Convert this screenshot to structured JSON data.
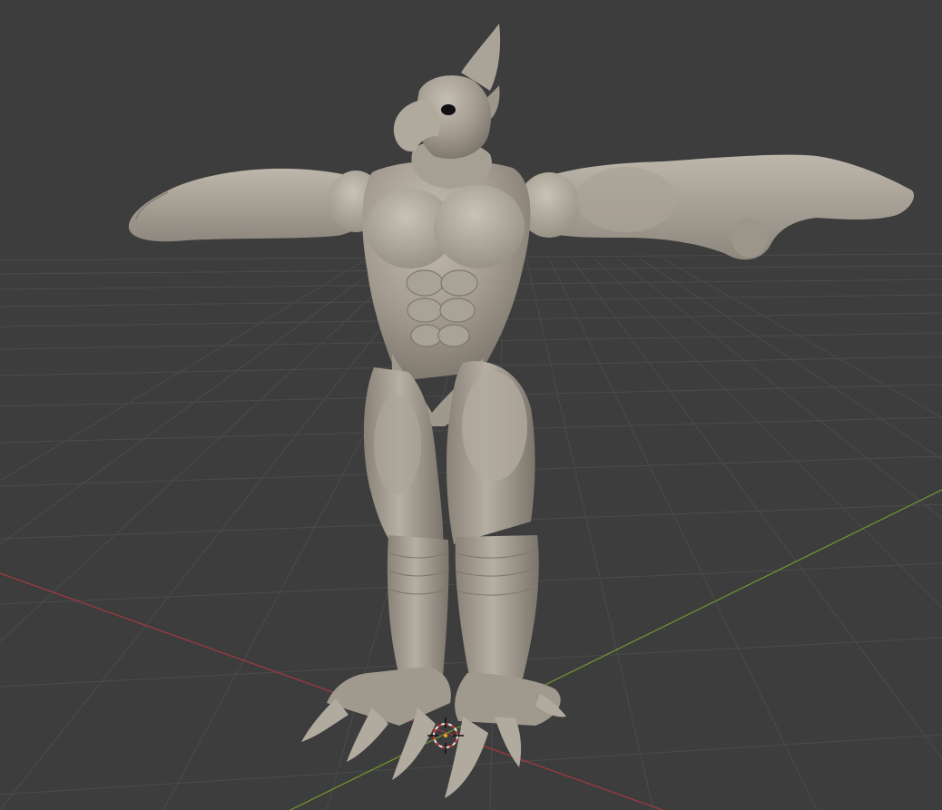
{
  "viewport": {
    "mode": "3d-viewport",
    "shading": "solid",
    "colors": {
      "background": "#3d3d3d",
      "grid_line": "#4c4c4c",
      "x_axis": "#9c3a42",
      "y_axis": "#6d9232",
      "model_base": "#a49c92",
      "model_light": "#c3bcb1",
      "model_shadow": "#6f685f",
      "eye": "#101010"
    }
  },
  "scene": {
    "model_icon": "sculpted-bird-creature-mesh",
    "cursor_icon": "3d-cursor-icon"
  }
}
